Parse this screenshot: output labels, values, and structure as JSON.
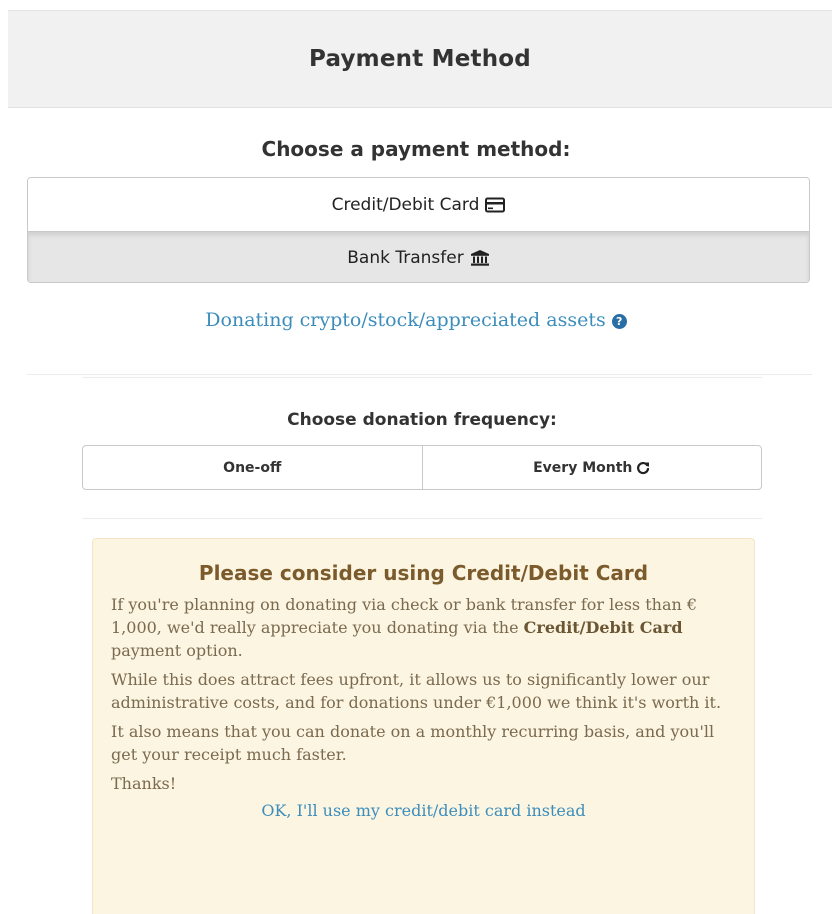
{
  "header": {
    "title": "Payment Method"
  },
  "payment": {
    "prompt": "Choose a payment method:",
    "options": [
      {
        "label": "Credit/Debit Card",
        "icon": "credit-card-icon",
        "selected": false
      },
      {
        "label": "Bank Transfer",
        "icon": "bank-icon",
        "selected": true
      }
    ],
    "crypto_link": "Donating crypto/stock/appreciated assets",
    "crypto_help_icon": "question-circle-icon"
  },
  "frequency": {
    "prompt": "Choose donation frequency:",
    "options": [
      {
        "label": "One-off",
        "selected": false
      },
      {
        "label": "Every Month",
        "icon": "refresh-icon",
        "selected": false
      }
    ]
  },
  "notice": {
    "title": "Please consider using Credit/Debit Card",
    "p1_before": "If you're planning on donating via check or bank transfer for less than € 1,000, we'd really appreciate you donating via the ",
    "p1_bold": "Credit/Debit Card",
    "p1_after": " payment option.",
    "p2": "While this does attract fees upfront, it allows us to significantly lower our administrative costs, and for donations under €1,000 we think it's worth it.",
    "p3": "It also means that you can donate on a monthly recurring basis, and you'll get your receipt much faster.",
    "p4": "Thanks!",
    "ok_link": "OK, I'll use my credit/debit card instead"
  },
  "colors": {
    "link": "#3c8dbc",
    "notice_bg": "#fcf5e1",
    "notice_title": "#7b5a2c",
    "selected_bg": "#e6e6e6"
  }
}
